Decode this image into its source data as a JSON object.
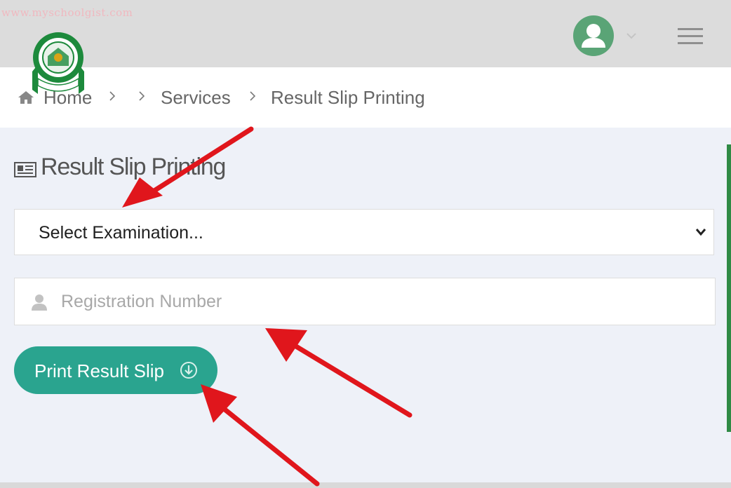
{
  "watermark": "www.myschoolgist.com",
  "breadcrumb": {
    "items": [
      {
        "label": "Home"
      },
      {
        "label": "Services"
      },
      {
        "label": "Result Slip Printing"
      }
    ]
  },
  "page": {
    "title": "Result Slip Printing"
  },
  "form": {
    "examination_select": {
      "selected": "Select Examination..."
    },
    "registration_input": {
      "value": "",
      "placeholder": "Registration Number"
    },
    "print_button": {
      "label": "Print Result Slip"
    }
  },
  "colors": {
    "topbar": "#dcdcdc",
    "avatar": "#5aa476",
    "button": "#2aa48f",
    "background": "#eef1f8",
    "annotation_arrow": "#e0161c"
  },
  "icons": [
    "home-icon",
    "chevron-right-icon",
    "newspaper-icon",
    "chevron-down-icon",
    "user-icon",
    "download-circle-icon",
    "hamburger-menu-icon",
    "avatar-icon"
  ]
}
